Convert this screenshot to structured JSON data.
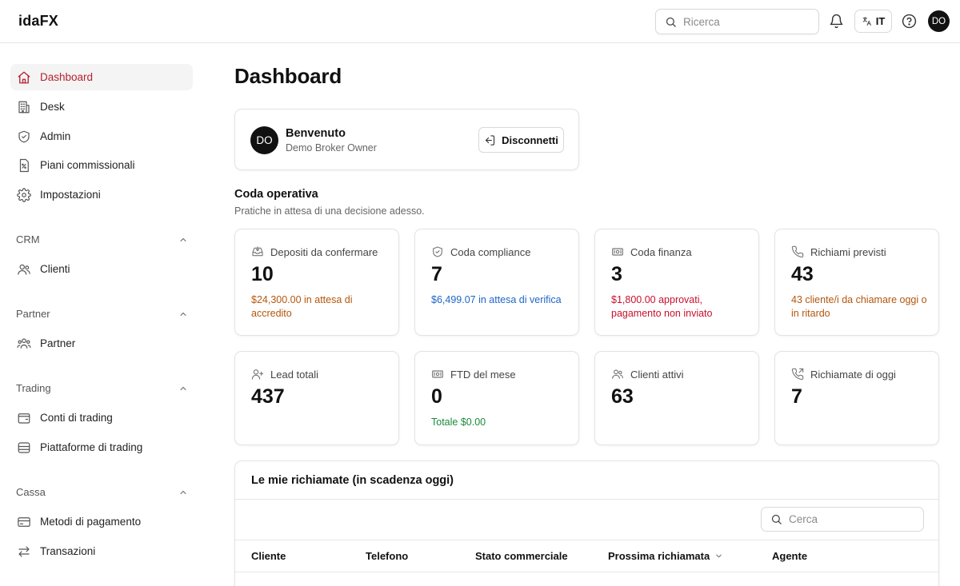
{
  "app": {
    "logo": "idaFX"
  },
  "topbar": {
    "search_placeholder": "Ricerca",
    "language": "IT",
    "user_initials": "DO"
  },
  "sidebar": {
    "items": [
      {
        "label": "Dashboard",
        "icon": "home-icon",
        "active": true
      },
      {
        "label": "Desk",
        "icon": "building-icon"
      },
      {
        "label": "Admin",
        "icon": "shield-check-icon"
      },
      {
        "label": "Piani commissionali",
        "icon": "percent-document-icon"
      },
      {
        "label": "Impostazioni",
        "icon": "gear-icon"
      }
    ],
    "groups": [
      {
        "title": "CRM",
        "items": [
          {
            "label": "Clienti",
            "icon": "users-icon"
          }
        ]
      },
      {
        "title": "Partner",
        "items": [
          {
            "label": "Partner",
            "icon": "handshake-icon"
          }
        ]
      },
      {
        "title": "Trading",
        "items": [
          {
            "label": "Conti di trading",
            "icon": "wallet-icon"
          },
          {
            "label": "Piattaforme di trading",
            "icon": "database-icon"
          }
        ]
      },
      {
        "title": "Cassa",
        "items": [
          {
            "label": "Metodi di pagamento",
            "icon": "credit-card-icon"
          },
          {
            "label": "Transazioni",
            "icon": "arrows-swap-icon"
          }
        ]
      }
    ]
  },
  "main": {
    "title": "Dashboard",
    "welcome": {
      "initials": "DO",
      "greeting": "Benvenuto",
      "role": "Demo Broker Owner",
      "logout_label": "Disconnetti"
    },
    "queue": {
      "title": "Coda operativa",
      "subtitle": "Pratiche in attesa di una decisione adesso."
    },
    "cards": [
      {
        "label": "Depositi da confermare",
        "value": "10",
        "note": "$24,300.00 in attesa di accredito",
        "note_color": "#b4560b",
        "icon": "inbox-download-icon"
      },
      {
        "label": "Coda compliance",
        "value": "7",
        "note": "$6,499.07 in attesa di verifica",
        "note_color": "#1f66c7",
        "icon": "shield-icon"
      },
      {
        "label": "Coda finanza",
        "value": "3",
        "note": "$1,800.00 approvati, pagamento non inviato",
        "note_color": "#c8102e",
        "icon": "banknote-icon"
      },
      {
        "label": "Richiami previsti",
        "value": "43",
        "note": "43 cliente/i da chiamare oggi o in ritardo",
        "note_color": "#b4560b",
        "icon": "phone-icon"
      },
      {
        "label": "Lead totali",
        "value": "437",
        "note": "",
        "icon": "user-plus-icon"
      },
      {
        "label": "FTD del mese",
        "value": "0",
        "note": "Totale $0.00",
        "note_color": "#1a8a3c",
        "icon": "banknote-icon"
      },
      {
        "label": "Clienti attivi",
        "value": "63",
        "note": "",
        "icon": "users-icon"
      },
      {
        "label": "Richiamate di oggi",
        "value": "7",
        "note": "",
        "icon": "phone-outgoing-icon"
      }
    ],
    "callbacks": {
      "title": "Le mie richiamate (in scadenza oggi)",
      "search_placeholder": "Cerca",
      "columns": [
        "Cliente",
        "Telefono",
        "Stato commerciale",
        "Prossima richiamata",
        "Agente"
      ]
    }
  },
  "colors": {
    "accent_red": "#b4232f",
    "active_bg": "#f4f4f4",
    "border": "#e3e3e3"
  }
}
